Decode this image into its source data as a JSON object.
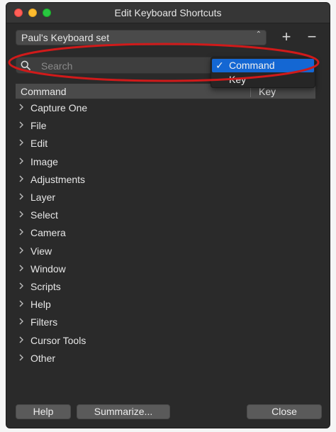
{
  "window": {
    "title": "Edit Keyboard Shortcuts"
  },
  "shortcut_set": {
    "selected": "Paul's Keyboard set",
    "add_label": "+",
    "remove_label": "−"
  },
  "search": {
    "placeholder": "Search",
    "value": ""
  },
  "search_scope_menu": {
    "items": [
      {
        "label": "Command",
        "checked": true,
        "check_mark": "✓"
      },
      {
        "label": "Key",
        "checked": false
      }
    ]
  },
  "table": {
    "columns": [
      "Command",
      "Key"
    ],
    "rows": [
      {
        "label": "Capture One"
      },
      {
        "label": "File"
      },
      {
        "label": "Edit"
      },
      {
        "label": "Image"
      },
      {
        "label": "Adjustments"
      },
      {
        "label": "Layer"
      },
      {
        "label": "Select"
      },
      {
        "label": "Camera"
      },
      {
        "label": "View"
      },
      {
        "label": "Window"
      },
      {
        "label": "Scripts"
      },
      {
        "label": "Help"
      },
      {
        "label": "Filters"
      },
      {
        "label": "Cursor Tools"
      },
      {
        "label": "Other"
      }
    ]
  },
  "buttons": {
    "help": "Help",
    "summarize": "Summarize...",
    "close": "Close"
  },
  "colors": {
    "annotation_ring": "#d01a1a",
    "selection": "#1467d3",
    "window_bg": "#2a2a2a"
  }
}
